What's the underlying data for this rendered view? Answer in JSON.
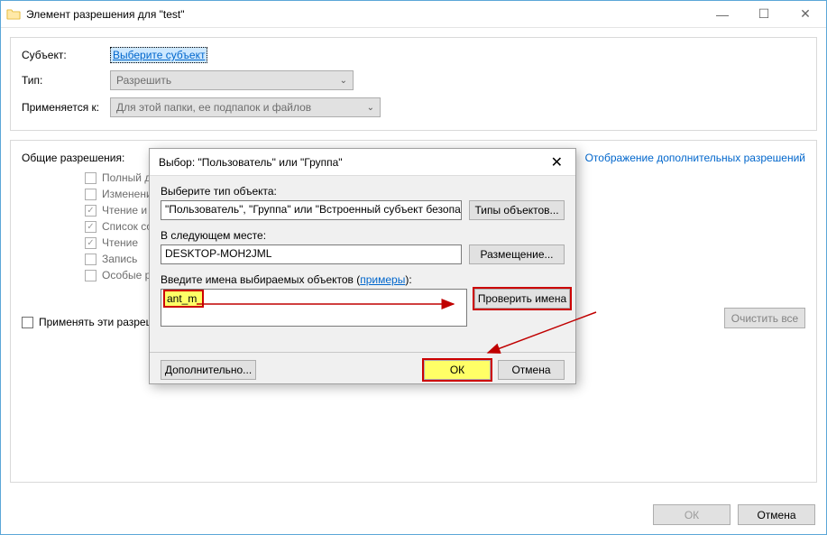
{
  "window": {
    "title": "Элемент разрешения для \"test\""
  },
  "main": {
    "subject_label": "Субъект:",
    "subject_link": "Выберите субъект",
    "type_label": "Тип:",
    "type_value": "Разрешить",
    "applies_label": "Применяется к:",
    "applies_value": "Для этой папки, ее подпапок и файлов"
  },
  "perm": {
    "header": "Общие разрешения:",
    "adv_link": "Отображение дополнительных разрешений",
    "checks": {
      "c0": {
        "label": "Полный д",
        "checked": false
      },
      "c1": {
        "label": "Изменени",
        "checked": false
      },
      "c2": {
        "label": "Чтение и в",
        "checked": true
      },
      "c3": {
        "label": "Список со",
        "checked": true
      },
      "c4": {
        "label": "Чтение",
        "checked": true
      },
      "c5": {
        "label": "Запись",
        "checked": false
      },
      "c6": {
        "label": "Особые р",
        "checked": false
      }
    },
    "apply_only": "Применять эти разреш",
    "clear": "Очистить все"
  },
  "buttons": {
    "ok": "ОК",
    "cancel": "Отмена"
  },
  "modal": {
    "title": "Выбор: \"Пользователь\" или \"Группа\"",
    "obj_type_label": "Выберите тип объекта:",
    "obj_type_value": "\"Пользователь\", \"Группа\" или \"Встроенный субъект безопасности\"",
    "obj_type_btn": "Типы объектов...",
    "location_label": "В следующем месте:",
    "location_value": "DESKTOP-MOH2JML",
    "location_btn": "Размещение...",
    "names_label_prefix": "Введите имена выбираемых объектов (",
    "names_label_link": "примеры",
    "names_label_suffix": "):",
    "names_value": "ant_m",
    "check_names": "Проверить имена",
    "advanced": "Дополнительно...",
    "ok": "ОК",
    "cancel": "Отмена"
  }
}
